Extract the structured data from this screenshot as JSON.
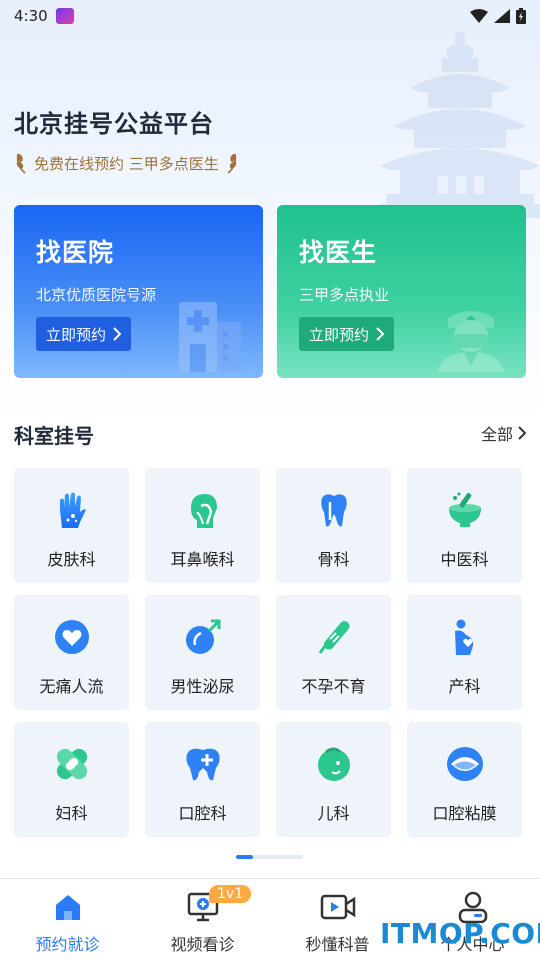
{
  "status_bar": {
    "time": "4:30"
  },
  "header": {
    "title": "北京挂号公益平台",
    "subtitle": "免费在线预约 三甲多点医生"
  },
  "cards": [
    {
      "title": "找医院",
      "desc": "北京优质医院号源",
      "button": "立即预约",
      "color": "#1a66f4"
    },
    {
      "title": "找医生",
      "desc": "三甲多点执业",
      "button": "立即预约",
      "color": "#21c08f"
    }
  ],
  "section": {
    "title": "科室挂号",
    "see_all": "全部"
  },
  "departments": [
    {
      "label": "皮肤科",
      "icon": "hand-icon"
    },
    {
      "label": "耳鼻喉科",
      "icon": "ent-head-icon"
    },
    {
      "label": "骨科",
      "icon": "tooth-bone-icon"
    },
    {
      "label": "中医科",
      "icon": "mortar-icon"
    },
    {
      "label": "无痛人流",
      "icon": "heart-circle-icon"
    },
    {
      "label": "男性泌尿",
      "icon": "male-symbol-icon"
    },
    {
      "label": "不孕不育",
      "icon": "thermometer-icon"
    },
    {
      "label": "产科",
      "icon": "pregnant-icon"
    },
    {
      "label": "妇科",
      "icon": "bandage-icon"
    },
    {
      "label": "口腔科",
      "icon": "tooth-plus-icon"
    },
    {
      "label": "儿科",
      "icon": "baby-face-icon"
    },
    {
      "label": "口腔粘膜",
      "icon": "mouth-icon"
    }
  ],
  "tabs": [
    {
      "label": "预约就诊",
      "icon": "home-icon",
      "active": true
    },
    {
      "label": "视频看诊",
      "icon": "monitor-plus-icon",
      "badge": "1v1"
    },
    {
      "label": "秒懂科普",
      "icon": "video-camera-icon"
    },
    {
      "label": "个人中心",
      "icon": "user-icon"
    }
  ],
  "watermark": "ITMOP.COM",
  "colors": {
    "primary": "#2b7bf6",
    "green": "#21c08f",
    "gold": "#a0723a",
    "badge": "#ffa940"
  }
}
